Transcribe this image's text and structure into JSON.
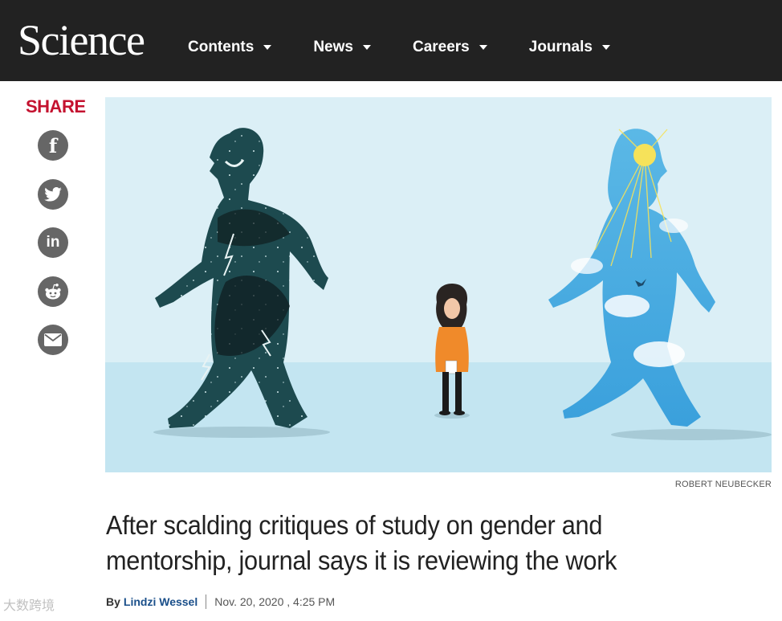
{
  "header": {
    "logo": "Science",
    "nav": [
      {
        "label": "Contents"
      },
      {
        "label": "News"
      },
      {
        "label": "Careers"
      },
      {
        "label": "Journals"
      }
    ]
  },
  "share": {
    "title": "SHARE",
    "buttons": [
      {
        "icon": "facebook-icon",
        "glyph": "f"
      },
      {
        "icon": "twitter-icon",
        "glyph": "t"
      },
      {
        "icon": "linkedin-icon",
        "glyph": "in"
      },
      {
        "icon": "reddit-icon",
        "glyph": "r"
      },
      {
        "icon": "email-icon",
        "glyph": "✉"
      }
    ]
  },
  "hero": {
    "credit": "ROBERT NEUBECKER"
  },
  "article": {
    "headline": "After scalding critiques of study on gender and mentorship, journal says it is reviewing the work",
    "by_label": "By",
    "author": "Lindzi Wessel",
    "date": "Nov. 20, 2020 , 4:25 PM"
  },
  "watermark": "大数跨境",
  "colors": {
    "topbar": "#222222",
    "share_red": "#c4122f",
    "author_link": "#1a4f8a",
    "hero_sky": "#d6eef6",
    "hero_ground": "#bfe4f1"
  }
}
